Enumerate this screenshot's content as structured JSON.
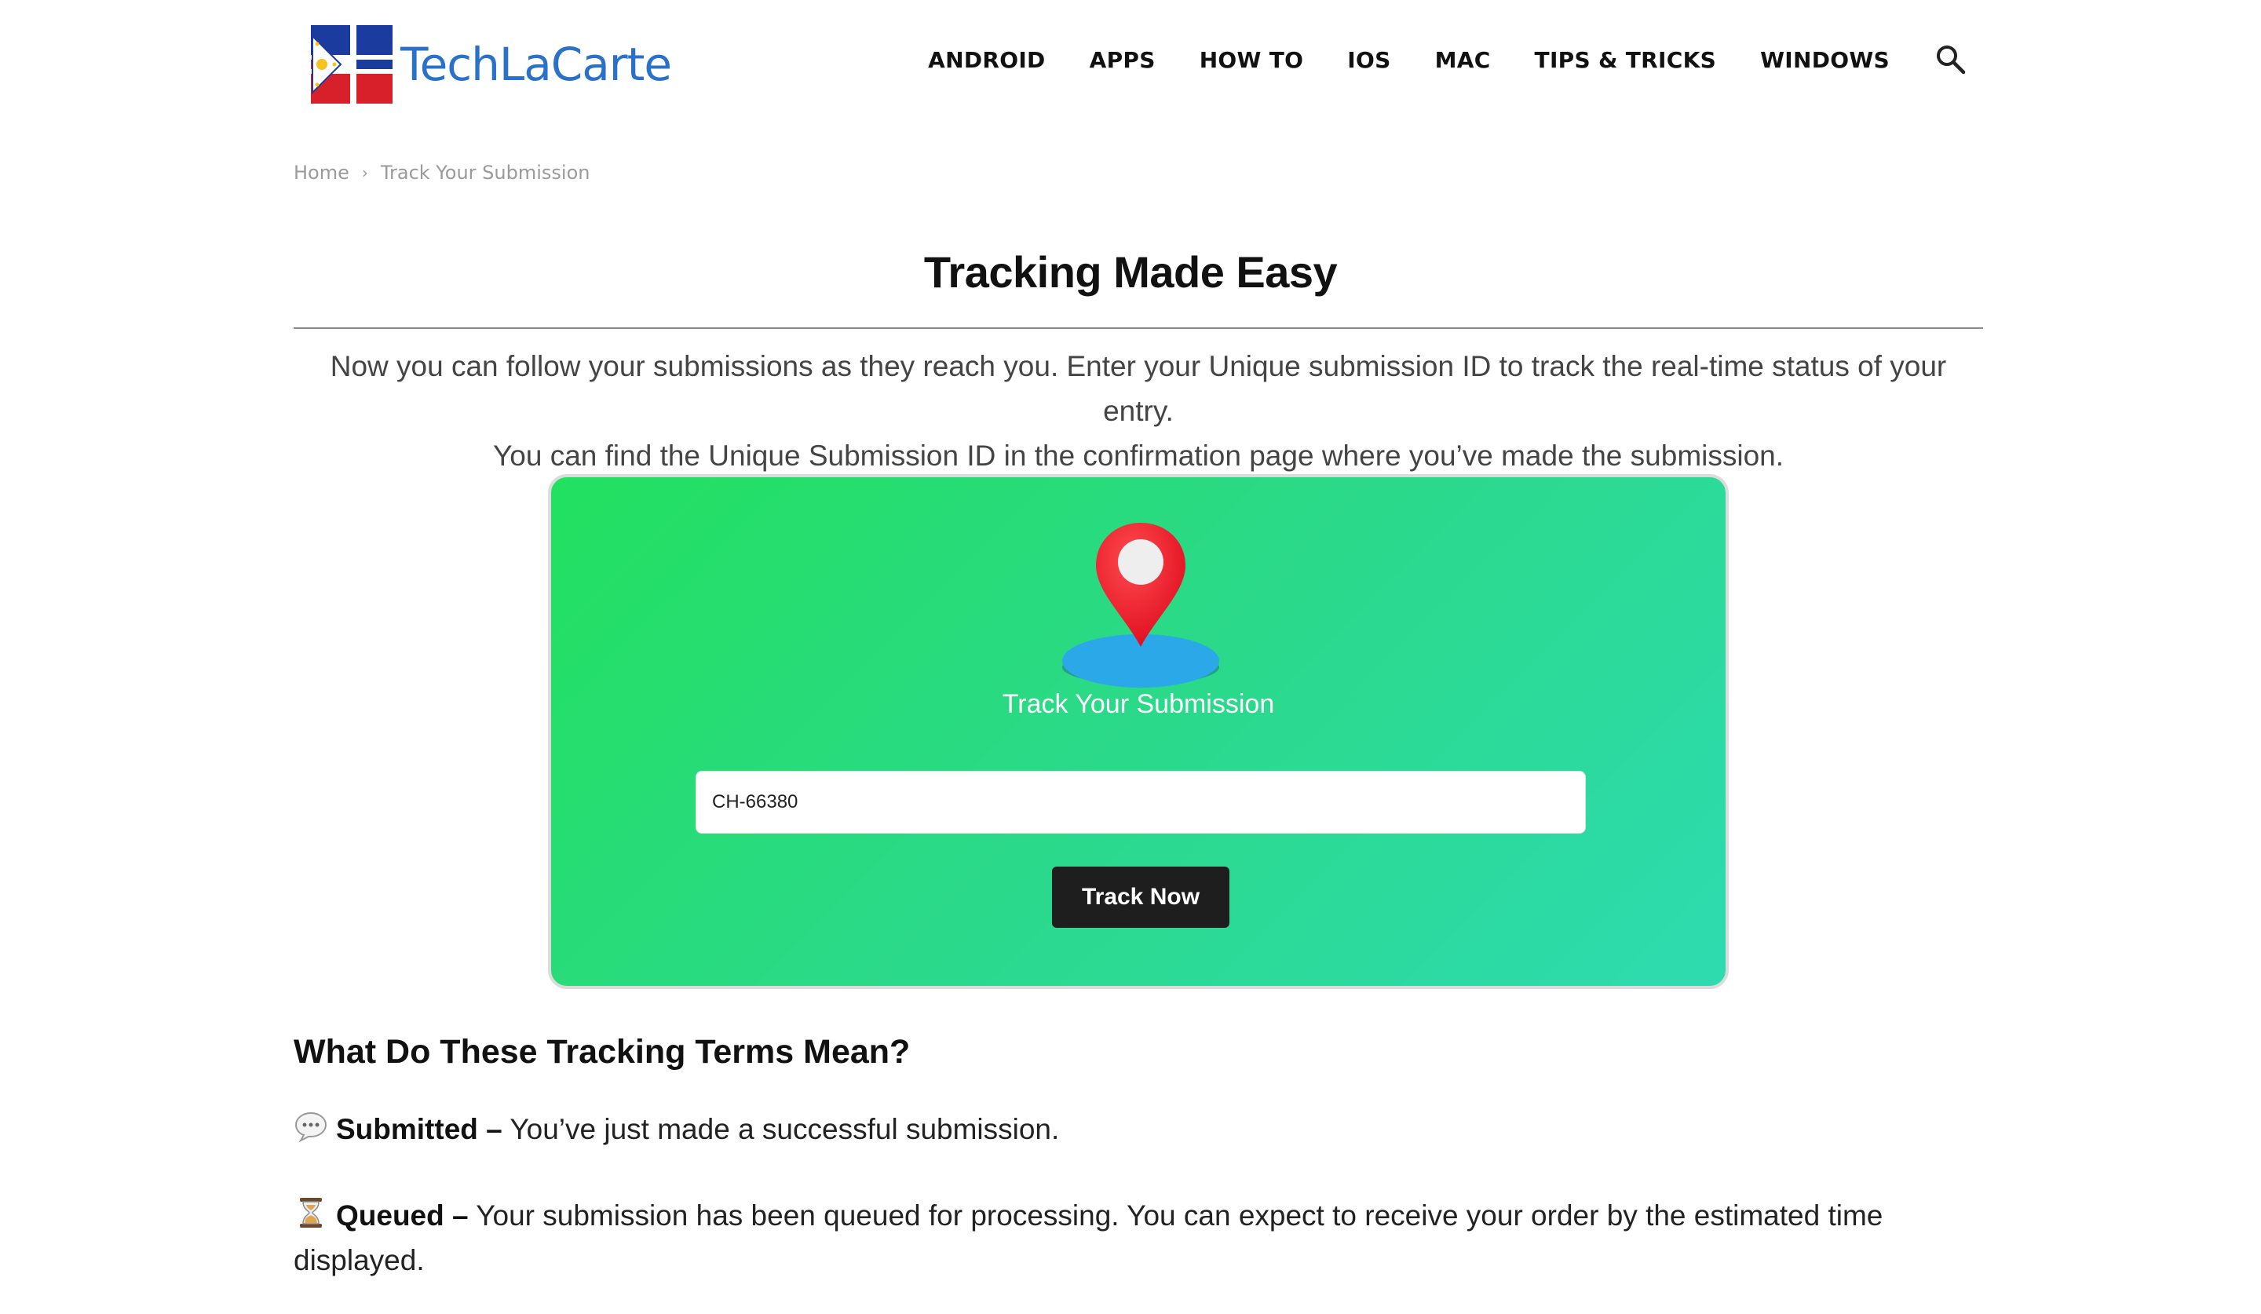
{
  "header": {
    "logo_text": "TechLaCarte",
    "nav": [
      "ANDROID",
      "APPS",
      "HOW TO",
      "IOS",
      "MAC",
      "TIPS & TRICKS",
      "WINDOWS"
    ],
    "search_icon": "search-icon"
  },
  "breadcrumb": {
    "home": "Home",
    "separator": "›",
    "current": "Track Your Submission"
  },
  "page": {
    "title": "Tracking Made Easy",
    "intro_line1": "Now you can follow your submissions as they reach you. Enter your Unique submission ID to track the real-time status of your entry.",
    "intro_line2": "You can find the Unique Submission ID in the confirmation page where you’ve made the submission."
  },
  "tracker": {
    "icon": "location-pin-icon",
    "title": "Track Your Submission",
    "input_value": "CH-66380",
    "button_label": "Track Now",
    "colors": {
      "gradient_start": "#22e05f",
      "gradient_end": "#2ddbb0",
      "pin": "#f0232e",
      "base": "#2aa8e8",
      "button": "#1e1e1e"
    }
  },
  "terms": {
    "heading": "What Do These Tracking Terms Mean?",
    "items": [
      {
        "icon": "speech-bubble-icon",
        "term": "Submitted –",
        "description": " You’ve just made a successful submission."
      },
      {
        "icon": "hourglass-icon",
        "term": "Queued –",
        "description": " Your submission has been queued for processing. You can expect to receive your order by the estimated time displayed."
      }
    ]
  },
  "colors": {
    "logo_blue": "#2a72c9",
    "logo_red": "#d8202a",
    "logo_navy": "#1b3c9e"
  }
}
